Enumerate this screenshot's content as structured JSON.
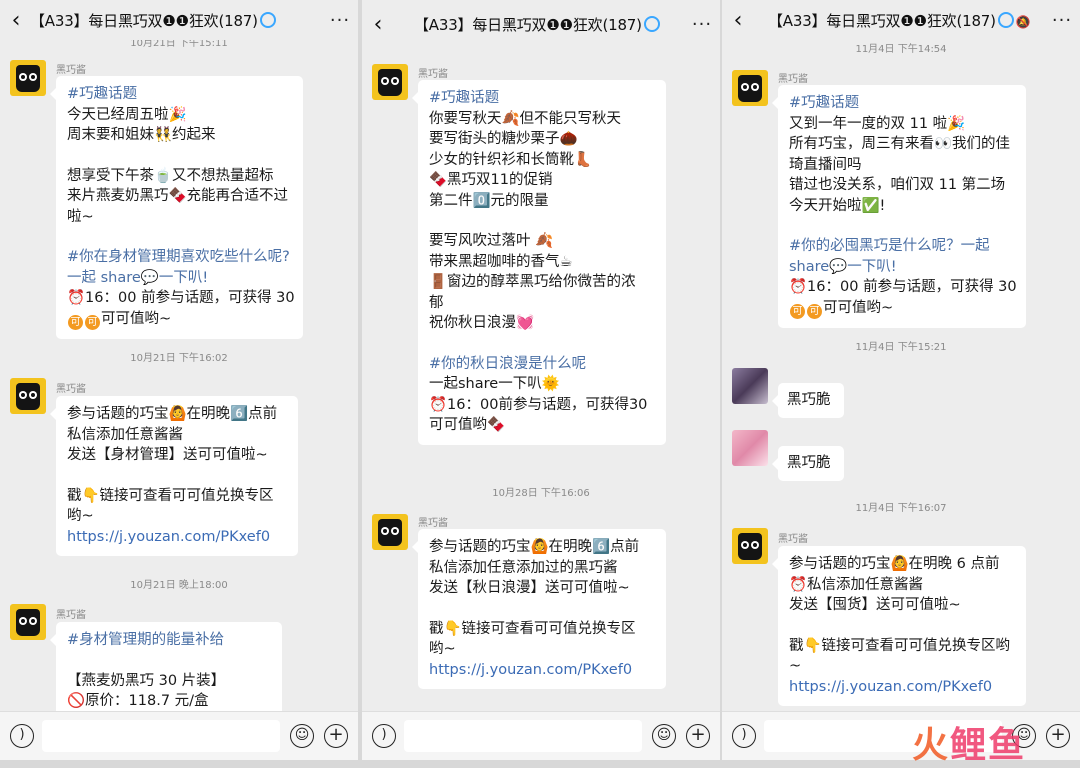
{
  "screens": [
    {
      "title": "【A33】每日黑巧双❶❶狂欢(187)",
      "back_icon": "chevron-left-icon",
      "more_icon": "ellipsis-icon",
      "top_timestamp": "10月21日 下午15:11",
      "messages": [
        {
          "timestamp": "",
          "sender": "黑巧酱",
          "lines": [
            "#巧趣话题",
            "今天已经周五啦🎉",
            "周末要和姐妹👯约起来",
            "",
            "想享受下午茶🍵又不想热量超标",
            "来片燕麦奶黑巧🍫充能再合适不过",
            "啦~",
            "",
            "#你在身材管理期喜欢吃些什么呢?",
            "一起 share💬一下叭!",
            "⏰16：00 前参与话题，可获得 30",
            "可可值哟~"
          ]
        },
        {
          "timestamp": "10月21日 下午16:02",
          "sender": "黑巧酱",
          "lines": [
            "参与话题的巧宝🙆在明晚6️⃣点前",
            "私信添加任意酱酱",
            "发送【身材管理】送可可值啦~",
            "",
            "戳👇链接可查看可可值兑换专区",
            "哟~",
            "https://j.youzan.com/PKxef0"
          ]
        },
        {
          "timestamp": "10月21日 晚上18:00",
          "sender": "黑巧酱",
          "lines": [
            "#身材管理期的能量补给",
            "",
            "【燕麦奶黑巧 30 片装】",
            "🚫原价：118.7 元/盒"
          ]
        }
      ]
    },
    {
      "title": "【A33】每日黑巧双❶❶狂欢(187)",
      "back_icon": "chevron-left-icon",
      "more_icon": "ellipsis-icon",
      "messages": [
        {
          "timestamp": "",
          "sender": "黑巧酱",
          "lines": [
            "#巧趣话题",
            "你要写秋天🍂但不能只写秋天",
            "要写街头的糖炒栗子🌰",
            "少女的针织衫和长筒靴👢",
            "🍫黑巧双11的促销",
            "第二件0️⃣元的限量",
            "",
            "要写风吹过落叶 🍂",
            "带来黑超咖啡的香气☕",
            "🚪窗边的醇萃黑巧给你微苦的浓",
            "郁",
            "祝你秋日浪漫💓",
            "",
            "#你的秋日浪漫是什么呢",
            "一起share一下叭🌞",
            "⏰16：00前参与话题，可获得30",
            "可可值哟🍫"
          ]
        },
        {
          "timestamp": "10月28日 下午16:06",
          "sender": "黑巧酱",
          "lines": [
            "参与话题的巧宝🙆在明晚6️⃣点前",
            "私信添加任意添加过的黑巧酱",
            "发送【秋日浪漫】送可可值啦~",
            "",
            "戳👇链接可查看可可值兑换专区",
            "哟~",
            "https://j.youzan.com/PKxef0"
          ]
        }
      ]
    },
    {
      "title": "【A33】每日黑巧双❶❶狂欢(187)",
      "back_icon": "chevron-left-icon",
      "more_icon": "ellipsis-icon",
      "top_timestamp": "11月4日 下午14:54",
      "messages": [
        {
          "timestamp": "",
          "sender": "黑巧酱",
          "lines": [
            "#巧趣话题",
            "又到一年一度的双 11 啦🎉",
            "所有巧宝，周三有来看👀我们的佳",
            "琦直播间吗",
            "错过也没关系，咱们双 11 第二场",
            "今天开始啦✅!",
            "",
            "#你的必囤黑巧是什么呢？一起",
            "share💬一下叭!",
            "⏰16：00 前参与话题，可获得 30",
            "可可值哟~"
          ]
        },
        {
          "timestamp": "11月4日 下午15:21",
          "sender": "",
          "lines": [
            "黑巧脆"
          ]
        },
        {
          "timestamp": "",
          "sender": "",
          "lines": [
            "黑巧脆"
          ]
        },
        {
          "timestamp": "11月4日 下午16:07",
          "sender": "黑巧酱",
          "lines": [
            "参与话题的巧宝🙆在明晚 6 点前",
            "⏰私信添加任意酱酱",
            "发送【囤货】送可可值啦~",
            "",
            "戳👇链接可查看可可值兑换专区哟",
            "~",
            "https://j.youzan.com/PKxef0"
          ]
        }
      ]
    }
  ],
  "coin_glyph": "可",
  "watermark": {
    "left": "火",
    "right": "鲤鱼"
  },
  "colors": {
    "bg": "#ededed",
    "bubble": "#ffffff",
    "hashtag": "#4a6fa5",
    "link": "#3b6bb5",
    "avatar": "#f3c31e",
    "coin": "#f39a21"
  }
}
